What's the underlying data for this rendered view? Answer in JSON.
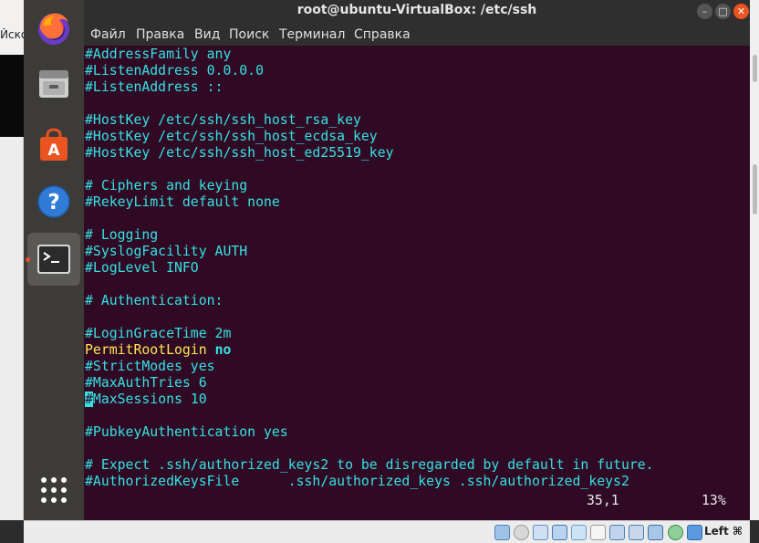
{
  "host": {
    "label": "Йско"
  },
  "window": {
    "title": "root@ubuntu-VirtualBox: /etc/ssh"
  },
  "menu": [
    "Файл",
    "Правка",
    "Вид",
    "Поиск",
    "Терминал",
    "Справка"
  ],
  "terminal": {
    "lines": [
      "#AddressFamily any",
      "#ListenAddress 0.0.0.0",
      "#ListenAddress ::",
      "",
      "#HostKey /etc/ssh/ssh_host_rsa_key",
      "#HostKey /etc/ssh/ssh_host_ecdsa_key",
      "#HostKey /etc/ssh/ssh_host_ed25519_key",
      "",
      "# Ciphers and keying",
      "#RekeyLimit default none",
      "",
      "# Logging",
      "#SyslogFacility AUTH",
      "#LogLevel INFO",
      "",
      "# Authentication:",
      "",
      "#LoginGraceTime 2m",
      {
        "key": "PermitRootLogin",
        "value": "no"
      },
      "#StrictModes yes",
      "#MaxAuthTries 6",
      {
        "cursor": "#",
        "rest": "MaxSessions 10"
      },
      "",
      "#PubkeyAuthentication yes",
      "",
      "# Expect .ssh/authorized_keys2 to be disregarded by default in future.",
      "#AuthorizedKeysFile      .ssh/authorized_keys .ssh/authorized_keys2"
    ],
    "status": {
      "position": "35,1",
      "percent": "13%"
    },
    "colors": {
      "background": "#300a24",
      "text": "#34e2e2",
      "keyword": "#fce94f"
    }
  },
  "vbox": {
    "host_key": "Left ⌘"
  }
}
